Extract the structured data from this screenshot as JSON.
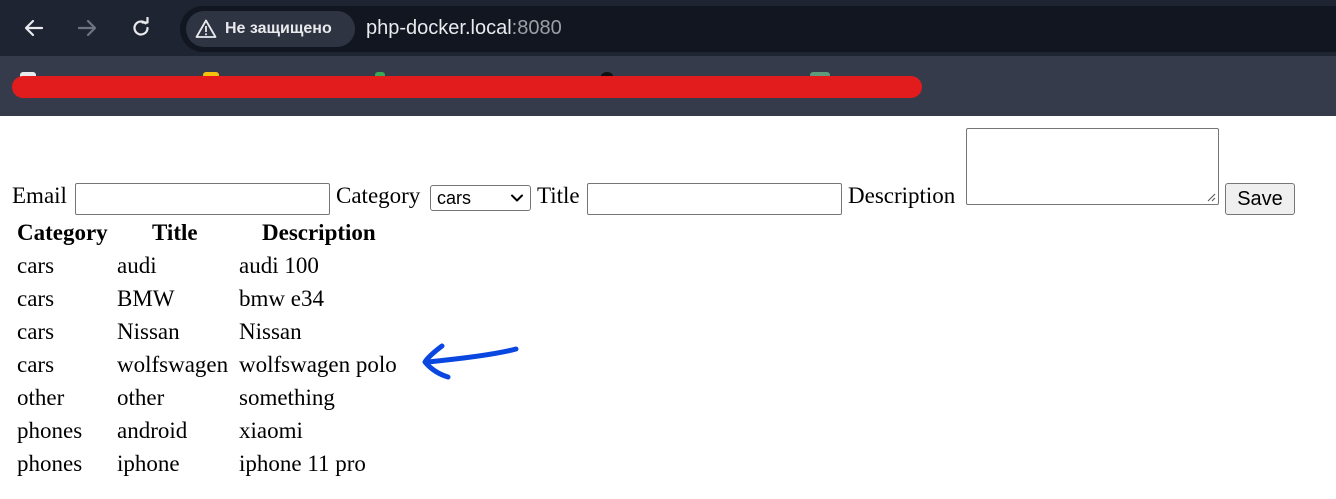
{
  "browser": {
    "security_label": "Не защищено",
    "url_host": "php-docker.local",
    "url_port": ":8080"
  },
  "form": {
    "email_label": "Email",
    "email_value": "",
    "category_label": "Category",
    "category_selected": "cars",
    "title_label": "Title",
    "title_value": "",
    "description_label": "Description",
    "description_value": "",
    "save_label": "Save"
  },
  "table": {
    "headers": [
      "Category",
      "Title",
      "Description"
    ],
    "rows": [
      [
        "cars",
        "audi",
        "audi 100"
      ],
      [
        "cars",
        "BMW",
        "bmw e34"
      ],
      [
        "cars",
        "Nissan",
        "Nissan"
      ],
      [
        "cars",
        "wolfswagen",
        "wolfswagen polo"
      ],
      [
        "other",
        "other",
        "something"
      ],
      [
        "phones",
        "android",
        "xiaomi"
      ],
      [
        "phones",
        "iphone",
        "iphone 11 pro"
      ]
    ]
  },
  "colors": {
    "chrome_bg": "#1f2432",
    "bookmarks_bg": "#353b4a",
    "redaction": "#e21c1c",
    "annotation_arrow": "#0a47e0"
  },
  "icons": {
    "back": "arrow-left-icon",
    "forward": "arrow-right-icon",
    "reload": "reload-icon",
    "security": "warning-triangle-icon",
    "select": "chevron-down-icon",
    "annotation": "hand-drawn-arrow-icon"
  }
}
